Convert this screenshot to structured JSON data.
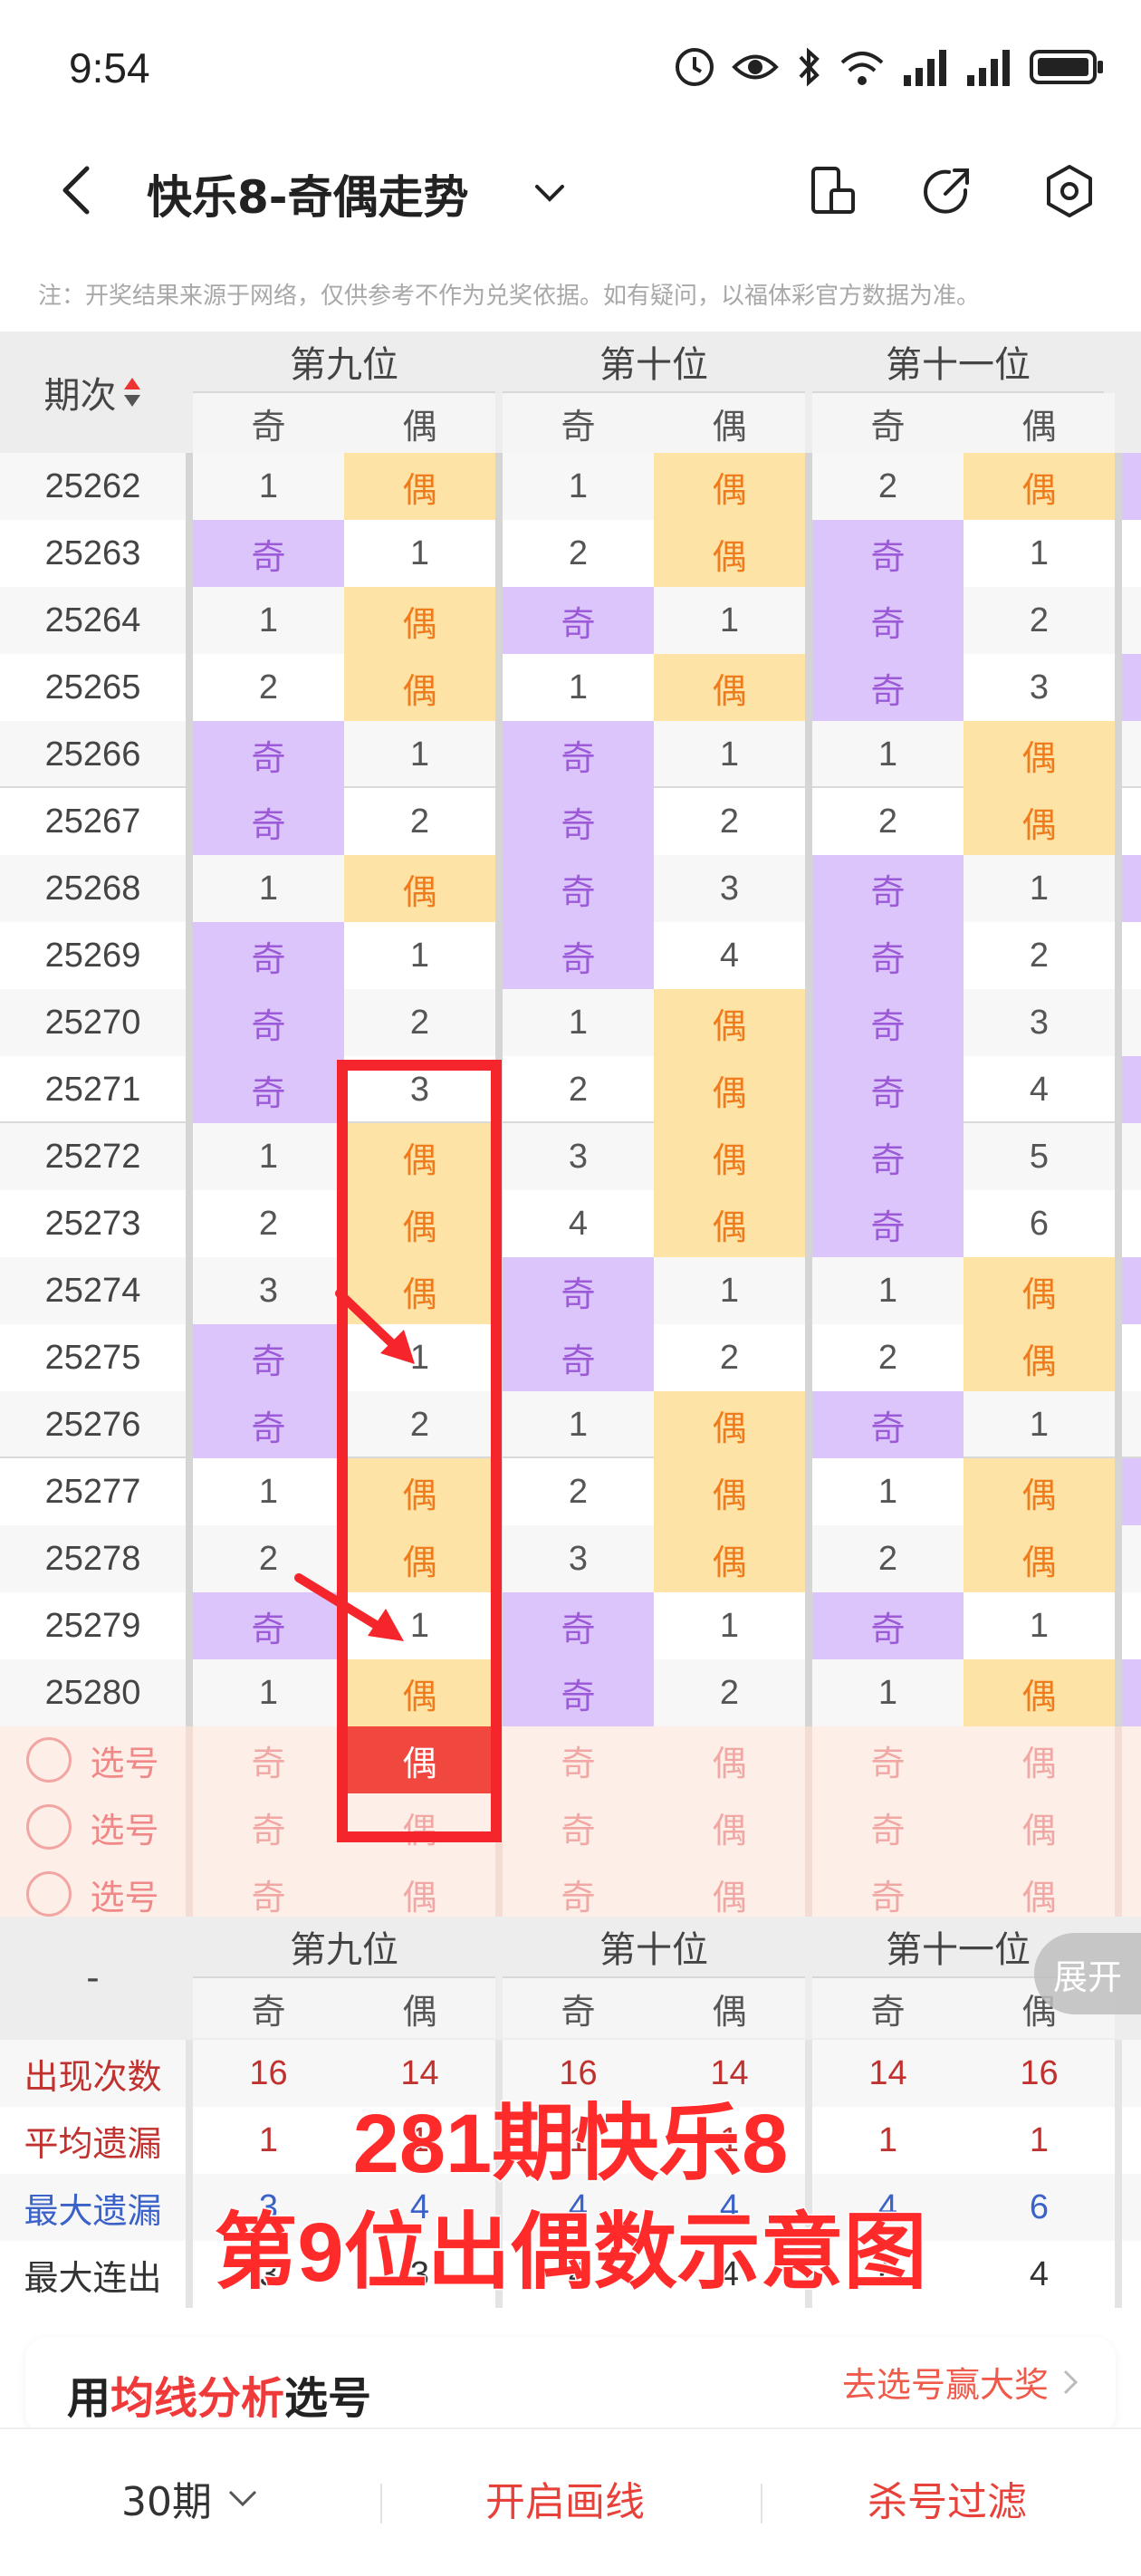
{
  "status": {
    "time": "9:54"
  },
  "nav": {
    "title": "快乐8-奇偶走势"
  },
  "notice": "注：开奖结果来源于网络，仅供参考不作为兑奖依据。如有疑问，以福体彩官方数据为准。",
  "header": {
    "issue_label": "期次",
    "groups": [
      "第九位",
      "第十位",
      "第十一位"
    ],
    "sub": [
      "奇",
      "偶",
      "奇",
      "偶",
      "奇",
      "偶"
    ]
  },
  "rows": [
    {
      "issue": "25262",
      "cells": [
        [
          "m",
          "1"
        ],
        [
          "e",
          "偶"
        ],
        [
          "m",
          "1"
        ],
        [
          "e",
          "偶"
        ],
        [
          "m",
          "2"
        ],
        [
          "e",
          "偶"
        ]
      ]
    },
    {
      "issue": "25263",
      "cells": [
        [
          "o",
          "奇"
        ],
        [
          "m",
          "1"
        ],
        [
          "m",
          "2"
        ],
        [
          "e",
          "偶"
        ],
        [
          "o",
          "奇"
        ],
        [
          "m",
          "1"
        ]
      ]
    },
    {
      "issue": "25264",
      "cells": [
        [
          "m",
          "1"
        ],
        [
          "e",
          "偶"
        ],
        [
          "o",
          "奇"
        ],
        [
          "m",
          "1"
        ],
        [
          "o",
          "奇"
        ],
        [
          "m",
          "2"
        ]
      ]
    },
    {
      "issue": "25265",
      "cells": [
        [
          "m",
          "2"
        ],
        [
          "e",
          "偶"
        ],
        [
          "m",
          "1"
        ],
        [
          "e",
          "偶"
        ],
        [
          "o",
          "奇"
        ],
        [
          "m",
          "3"
        ]
      ]
    },
    {
      "issue": "25266",
      "cells": [
        [
          "o",
          "奇"
        ],
        [
          "m",
          "1"
        ],
        [
          "o",
          "奇"
        ],
        [
          "m",
          "1"
        ],
        [
          "m",
          "1"
        ],
        [
          "e",
          "偶"
        ]
      ]
    },
    {
      "issue": "25267",
      "cells": [
        [
          "o",
          "奇"
        ],
        [
          "m",
          "2"
        ],
        [
          "o",
          "奇"
        ],
        [
          "m",
          "2"
        ],
        [
          "m",
          "2"
        ],
        [
          "e",
          "偶"
        ]
      ]
    },
    {
      "issue": "25268",
      "cells": [
        [
          "m",
          "1"
        ],
        [
          "e",
          "偶"
        ],
        [
          "o",
          "奇"
        ],
        [
          "m",
          "3"
        ],
        [
          "o",
          "奇"
        ],
        [
          "m",
          "1"
        ]
      ]
    },
    {
      "issue": "25269",
      "cells": [
        [
          "o",
          "奇"
        ],
        [
          "m",
          "1"
        ],
        [
          "o",
          "奇"
        ],
        [
          "m",
          "4"
        ],
        [
          "o",
          "奇"
        ],
        [
          "m",
          "2"
        ]
      ]
    },
    {
      "issue": "25270",
      "cells": [
        [
          "o",
          "奇"
        ],
        [
          "m",
          "2"
        ],
        [
          "m",
          "1"
        ],
        [
          "e",
          "偶"
        ],
        [
          "o",
          "奇"
        ],
        [
          "m",
          "3"
        ]
      ]
    },
    {
      "issue": "25271",
      "cells": [
        [
          "o",
          "奇"
        ],
        [
          "m",
          "3"
        ],
        [
          "m",
          "2"
        ],
        [
          "e",
          "偶"
        ],
        [
          "o",
          "奇"
        ],
        [
          "m",
          "4"
        ]
      ]
    },
    {
      "issue": "25272",
      "cells": [
        [
          "m",
          "1"
        ],
        [
          "e",
          "偶"
        ],
        [
          "m",
          "3"
        ],
        [
          "e",
          "偶"
        ],
        [
          "o",
          "奇"
        ],
        [
          "m",
          "5"
        ]
      ]
    },
    {
      "issue": "25273",
      "cells": [
        [
          "m",
          "2"
        ],
        [
          "e",
          "偶"
        ],
        [
          "m",
          "4"
        ],
        [
          "e",
          "偶"
        ],
        [
          "o",
          "奇"
        ],
        [
          "m",
          "6"
        ]
      ]
    },
    {
      "issue": "25274",
      "cells": [
        [
          "m",
          "3"
        ],
        [
          "e",
          "偶"
        ],
        [
          "o",
          "奇"
        ],
        [
          "m",
          "1"
        ],
        [
          "m",
          "1"
        ],
        [
          "e",
          "偶"
        ]
      ]
    },
    {
      "issue": "25275",
      "cells": [
        [
          "o",
          "奇"
        ],
        [
          "m",
          "1"
        ],
        [
          "o",
          "奇"
        ],
        [
          "m",
          "2"
        ],
        [
          "m",
          "2"
        ],
        [
          "e",
          "偶"
        ]
      ]
    },
    {
      "issue": "25276",
      "cells": [
        [
          "o",
          "奇"
        ],
        [
          "m",
          "2"
        ],
        [
          "m",
          "1"
        ],
        [
          "e",
          "偶"
        ],
        [
          "o",
          "奇"
        ],
        [
          "m",
          "1"
        ]
      ]
    },
    {
      "issue": "25277",
      "cells": [
        [
          "m",
          "1"
        ],
        [
          "e",
          "偶"
        ],
        [
          "m",
          "2"
        ],
        [
          "e",
          "偶"
        ],
        [
          "m",
          "1"
        ],
        [
          "e",
          "偶"
        ]
      ]
    },
    {
      "issue": "25278",
      "cells": [
        [
          "m",
          "2"
        ],
        [
          "e",
          "偶"
        ],
        [
          "m",
          "3"
        ],
        [
          "e",
          "偶"
        ],
        [
          "m",
          "2"
        ],
        [
          "e",
          "偶"
        ]
      ]
    },
    {
      "issue": "25279",
      "cells": [
        [
          "o",
          "奇"
        ],
        [
          "m",
          "1"
        ],
        [
          "o",
          "奇"
        ],
        [
          "m",
          "1"
        ],
        [
          "o",
          "奇"
        ],
        [
          "m",
          "1"
        ]
      ]
    },
    {
      "issue": "25280",
      "cells": [
        [
          "m",
          "1"
        ],
        [
          "e",
          "偶"
        ],
        [
          "o",
          "奇"
        ],
        [
          "m",
          "2"
        ],
        [
          "m",
          "1"
        ],
        [
          "e",
          "偶"
        ]
      ]
    }
  ],
  "select_rows": {
    "label": "选号",
    "cells": [
      "奇",
      "偶",
      "奇",
      "偶",
      "奇",
      "偶"
    ],
    "selected_index": 1,
    "count": 3
  },
  "stats": {
    "dash": "-",
    "groups": [
      "第九位",
      "第十位",
      "第十一位"
    ],
    "sub": [
      "奇",
      "偶",
      "奇",
      "偶",
      "奇",
      "偶"
    ],
    "rows": [
      {
        "label": "出现次数",
        "color": "#c0322f",
        "values": [
          "16",
          "14",
          "16",
          "14",
          "14",
          "16"
        ]
      },
      {
        "label": "平均遗漏",
        "color": "#c0322f",
        "values": [
          "1",
          "1",
          "1",
          "1",
          "1",
          "1"
        ]
      },
      {
        "label": "最大遗漏",
        "color": "#3a62c8",
        "values": [
          "3",
          "4",
          "4",
          "4",
          "4",
          "6"
        ]
      },
      {
        "label": "最大连出",
        "color": "#333333",
        "values": [
          "3",
          "3",
          "4",
          "4",
          "6",
          "4"
        ]
      }
    ]
  },
  "expand_label": "展开",
  "overlay": {
    "line1": "281期快乐8",
    "line2": "第9位出偶数示意图"
  },
  "promo": {
    "left_pre": "用",
    "left_hl": "均线分析",
    "left_post": "选号",
    "right": "去选号赢大奖"
  },
  "bottom": {
    "periods": "30期",
    "draw_lines": "开启画线",
    "filter": "杀号过滤"
  },
  "colors": {
    "odd_bg": "#dcc5fb",
    "even_bg": "#fde3a6",
    "accent_red": "#f03a3a",
    "annotation": "#f4262c"
  }
}
